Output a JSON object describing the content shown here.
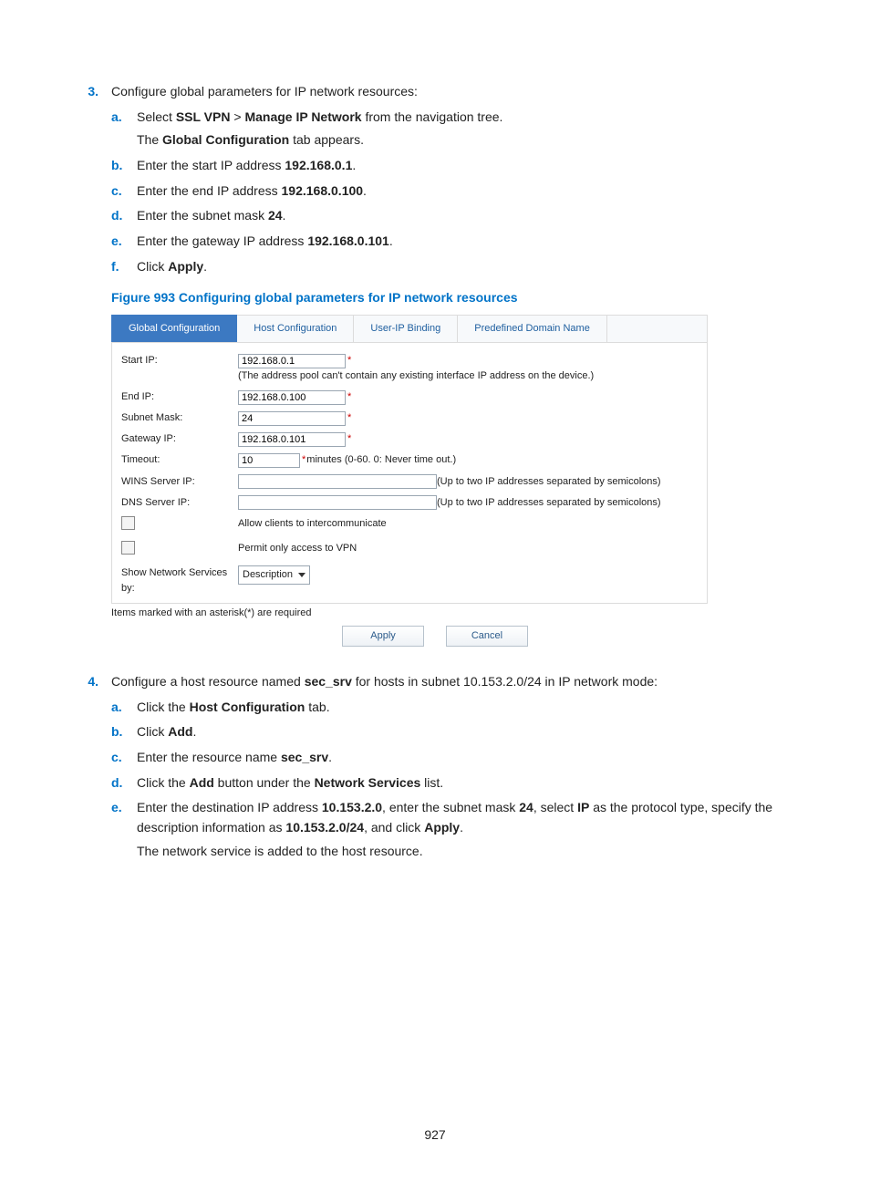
{
  "step3": {
    "num": "3.",
    "intro": "Configure global parameters for IP network resources:",
    "items": [
      {
        "letter": "a.",
        "parts": [
          "Select ",
          "SSL VPN",
          " > ",
          "Manage IP Network",
          " from the navigation tree."
        ],
        "extra_parts": [
          "The ",
          "Global Configuration",
          " tab appears."
        ]
      },
      {
        "letter": "b.",
        "parts": [
          "Enter the start IP address ",
          "192.168.0.1",
          "."
        ]
      },
      {
        "letter": "c.",
        "parts": [
          "Enter the end IP address ",
          "192.168.0.100",
          "."
        ]
      },
      {
        "letter": "d.",
        "parts": [
          "Enter the subnet mask ",
          "24",
          "."
        ]
      },
      {
        "letter": "e.",
        "parts": [
          "Enter the gateway IP address ",
          "192.168.0.101",
          "."
        ]
      },
      {
        "letter": "f.",
        "parts": [
          "Click ",
          "Apply",
          "."
        ]
      }
    ]
  },
  "figure_caption": "Figure 993 Configuring global parameters for IP network resources",
  "screenshot": {
    "tabs": [
      "Global Configuration",
      "Host Configuration",
      "User-IP Binding",
      "Predefined Domain Name"
    ],
    "rows": {
      "start_ip": {
        "label": "Start IP:",
        "value": "192.168.0.1",
        "note_before": "*",
        "note": "(The address pool can't contain any existing interface IP address on the device.)"
      },
      "end_ip": {
        "label": "End IP:",
        "value": "192.168.0.100",
        "note_before": "*"
      },
      "subnet": {
        "label": "Subnet Mask:",
        "value": "24",
        "note_before": "*"
      },
      "gateway": {
        "label": "Gateway IP:",
        "value": "192.168.0.101",
        "note_before": "*"
      },
      "timeout": {
        "label": "Timeout:",
        "value": "10",
        "note_before": "*",
        "note": "minutes (0-60. 0: Never time out.)"
      },
      "wins": {
        "label": "WINS Server IP:",
        "value": "",
        "note": "(Up to two IP addresses separated by semicolons)"
      },
      "dns": {
        "label": "DNS Server IP:",
        "value": "",
        "note": "(Up to two IP addresses separated by semicolons)"
      },
      "chk_intercom": "Allow clients to intercommunicate",
      "chk_vpnonly": "Permit only access to VPN",
      "showby_label": "Show Network Services by:",
      "showby_value": "Description"
    },
    "required_note": "Items marked with an asterisk(*) are required",
    "buttons": {
      "apply": "Apply",
      "cancel": "Cancel"
    }
  },
  "step4": {
    "num": "4.",
    "intro_parts": [
      "Configure a host resource named ",
      "sec_srv",
      " for hosts in subnet 10.153.2.0/24 in IP network mode:"
    ],
    "items": [
      {
        "letter": "a.",
        "parts": [
          "Click the ",
          "Host Configuration",
          " tab."
        ]
      },
      {
        "letter": "b.",
        "parts": [
          "Click ",
          "Add",
          "."
        ]
      },
      {
        "letter": "c.",
        "parts": [
          "Enter the resource name ",
          "sec_srv",
          "."
        ]
      },
      {
        "letter": "d.",
        "parts": [
          "Click the ",
          "Add",
          " button under the ",
          "Network Services",
          " list."
        ]
      },
      {
        "letter": "e.",
        "parts": [
          "Enter the destination IP address ",
          "10.153.2.0",
          ", enter the subnet mask ",
          "24",
          ", select ",
          "IP",
          " as the protocol type, specify the description information as ",
          "10.153.2.0/24",
          ", and click ",
          "Apply",
          "."
        ],
        "extra_plain": "The network service is added to the host resource."
      }
    ]
  },
  "page_number": "927"
}
